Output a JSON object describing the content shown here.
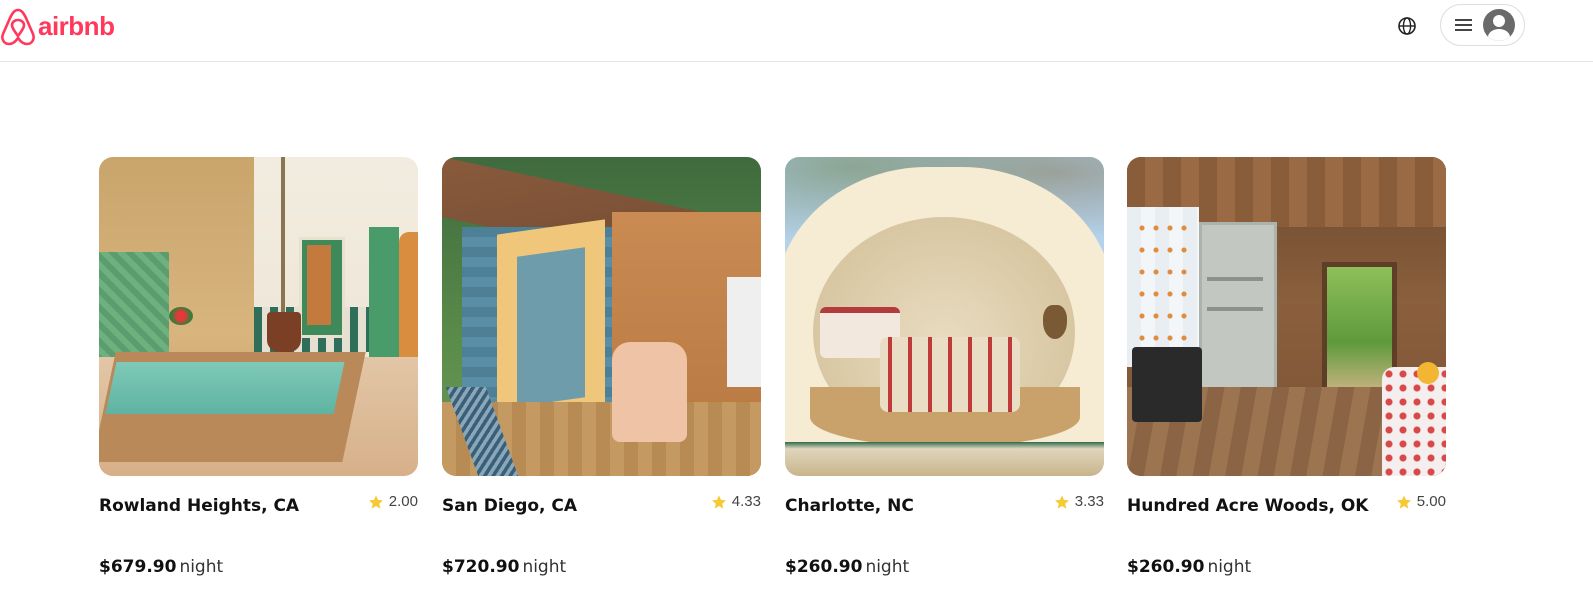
{
  "header": {
    "logo_text": "airbnb",
    "brand_color": "#ff385c",
    "globe_icon": "globe-icon",
    "menu_icon": "hamburger-menu-icon",
    "avatar_icon": "user-avatar-icon"
  },
  "listings": [
    {
      "location": "Rowland Heights, CA",
      "rating": "2.00",
      "price": "$679.90",
      "unit": "night"
    },
    {
      "location": "San Diego, CA",
      "rating": "4.33",
      "price": "$720.90",
      "unit": "night"
    },
    {
      "location": "Charlotte, NC",
      "rating": "3.33",
      "price": "$260.90",
      "unit": "night"
    },
    {
      "location": "Hundred Acre Woods, OK",
      "rating": "5.00",
      "price": "$260.90",
      "unit": "night"
    }
  ],
  "colors": {
    "star": "#f7c934",
    "text": "#222222",
    "border": "#dddddd"
  }
}
